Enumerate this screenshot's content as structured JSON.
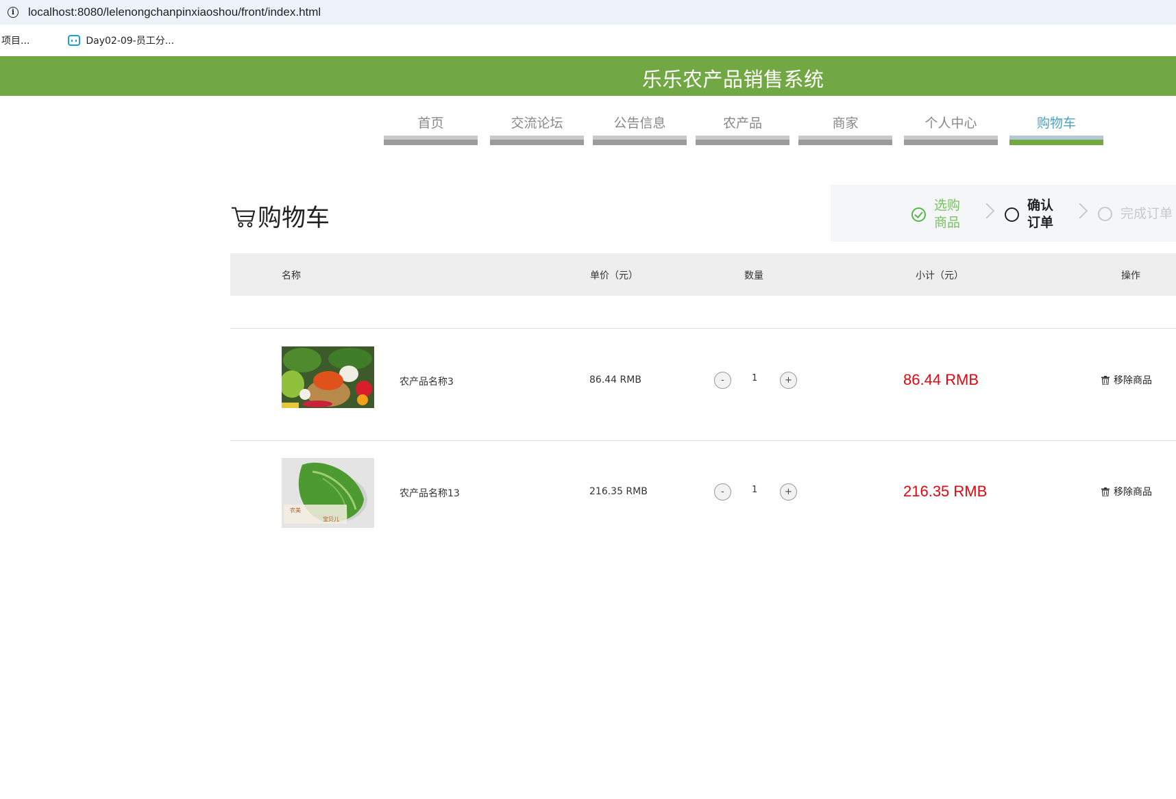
{
  "browser": {
    "url": "localhost:8080/lelenongchanpinxiaoshou/front/index.html",
    "bookmarks": [
      {
        "label": "项目...",
        "icon": ""
      },
      {
        "label": "Day02-09-员工分...",
        "icon": "bilibili-icon"
      }
    ]
  },
  "site": {
    "title": "乐乐农产品销售系统",
    "brand_color": "#72a844"
  },
  "nav": {
    "items": [
      {
        "label": "首页"
      },
      {
        "label": "交流论坛"
      },
      {
        "label": "公告信息"
      },
      {
        "label": "农产品"
      },
      {
        "label": "商家"
      },
      {
        "label": "个人中心"
      },
      {
        "label": "购物车",
        "active": true
      }
    ]
  },
  "cart": {
    "title": "购物车",
    "steps": [
      {
        "label_line1": "选购",
        "label_line2": "商品",
        "state": "done"
      },
      {
        "label_line1": "确认",
        "label_line2": "订单",
        "state": "current"
      },
      {
        "label": "完成订单",
        "state": "todo"
      }
    ],
    "columns": {
      "name": "名称",
      "unit_price": "单价（元）",
      "quantity": "数量",
      "subtotal": "小计（元）",
      "action": "操作"
    },
    "items": [
      {
        "name": "农产品名称3",
        "price": "86.44 RMB",
        "qty": "1",
        "subtotal": "86.44 RMB",
        "remove": "移除商品",
        "minus": "-",
        "plus": "+"
      },
      {
        "name": "农产品名称13",
        "price": "216.35 RMB",
        "qty": "1",
        "subtotal": "216.35 RMB",
        "remove": "移除商品",
        "minus": "-",
        "plus": "+"
      }
    ]
  }
}
